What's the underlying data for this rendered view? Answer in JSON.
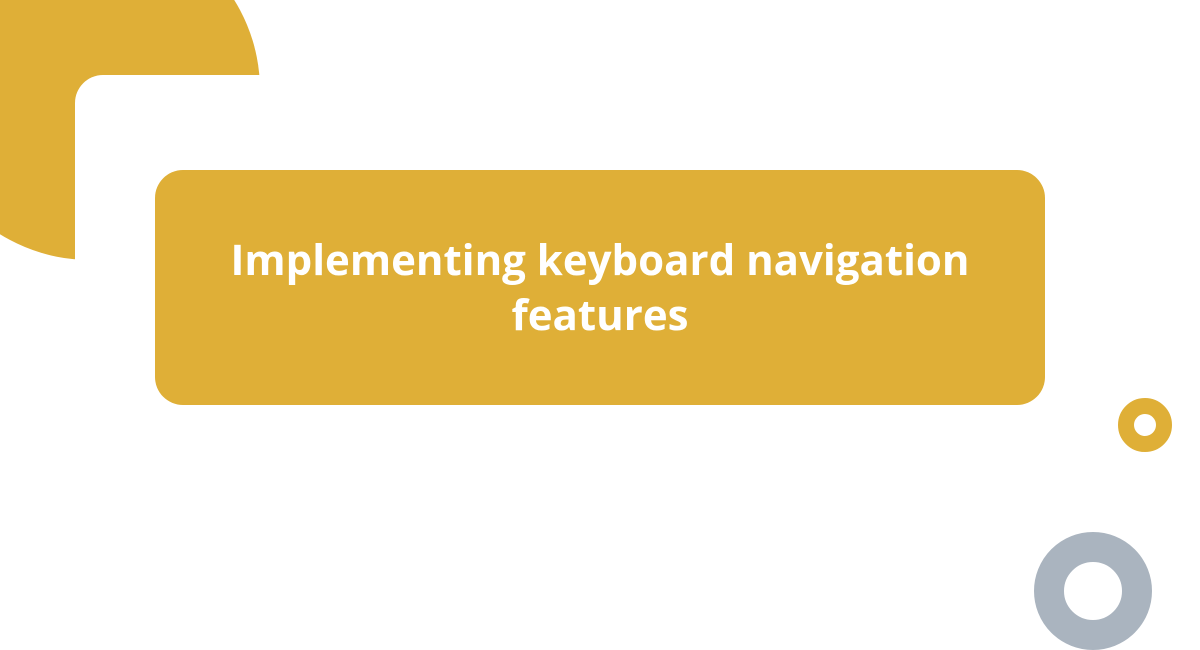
{
  "card": {
    "title": "Implementing keyboard navigation features"
  },
  "colors": {
    "accent": "#dfaf37",
    "neutral": "#aab4bf",
    "background": "#ffffff",
    "text": "#ffffff"
  }
}
